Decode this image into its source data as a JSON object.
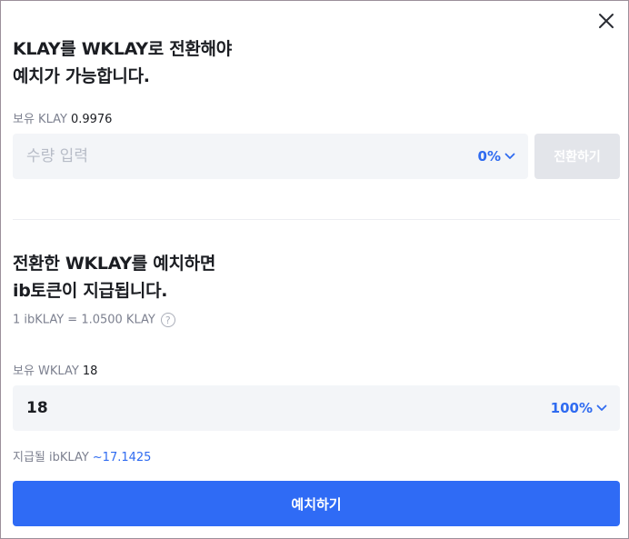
{
  "convert_section": {
    "title_line1": "KLAY를 WKLAY로 전환해야",
    "title_line2": "예치가 가능합니다.",
    "balance_label": "보유 KLAY",
    "balance_value": "0.9976",
    "amount_placeholder": "수량 입력",
    "percent": "0%",
    "convert_button": "전환하기"
  },
  "deposit_section": {
    "title_line1": "전환한 WKLAY를 예치하면",
    "title_line2": "ib토큰이 지급됩니다.",
    "rate_text": "1 ibKLAY = 1.0500 KLAY",
    "help_symbol": "?",
    "balance_label": "보유 WKLAY",
    "balance_value": "18",
    "amount_value": "18",
    "percent": "100%",
    "receive_label": "지급될 ibKLAY",
    "receive_value": "~17.1425",
    "deposit_button": "예치하기"
  },
  "icons": {
    "close": "close-icon",
    "percent_dropdown": "chevron-down-icon",
    "help": "help-icon"
  },
  "colors": {
    "accent": "#2f6bf5",
    "text_dark": "#1b1d22",
    "text_muted": "#7d8190",
    "input_bg": "#f3f5f8",
    "disabled_button": "#e3e5ea"
  }
}
